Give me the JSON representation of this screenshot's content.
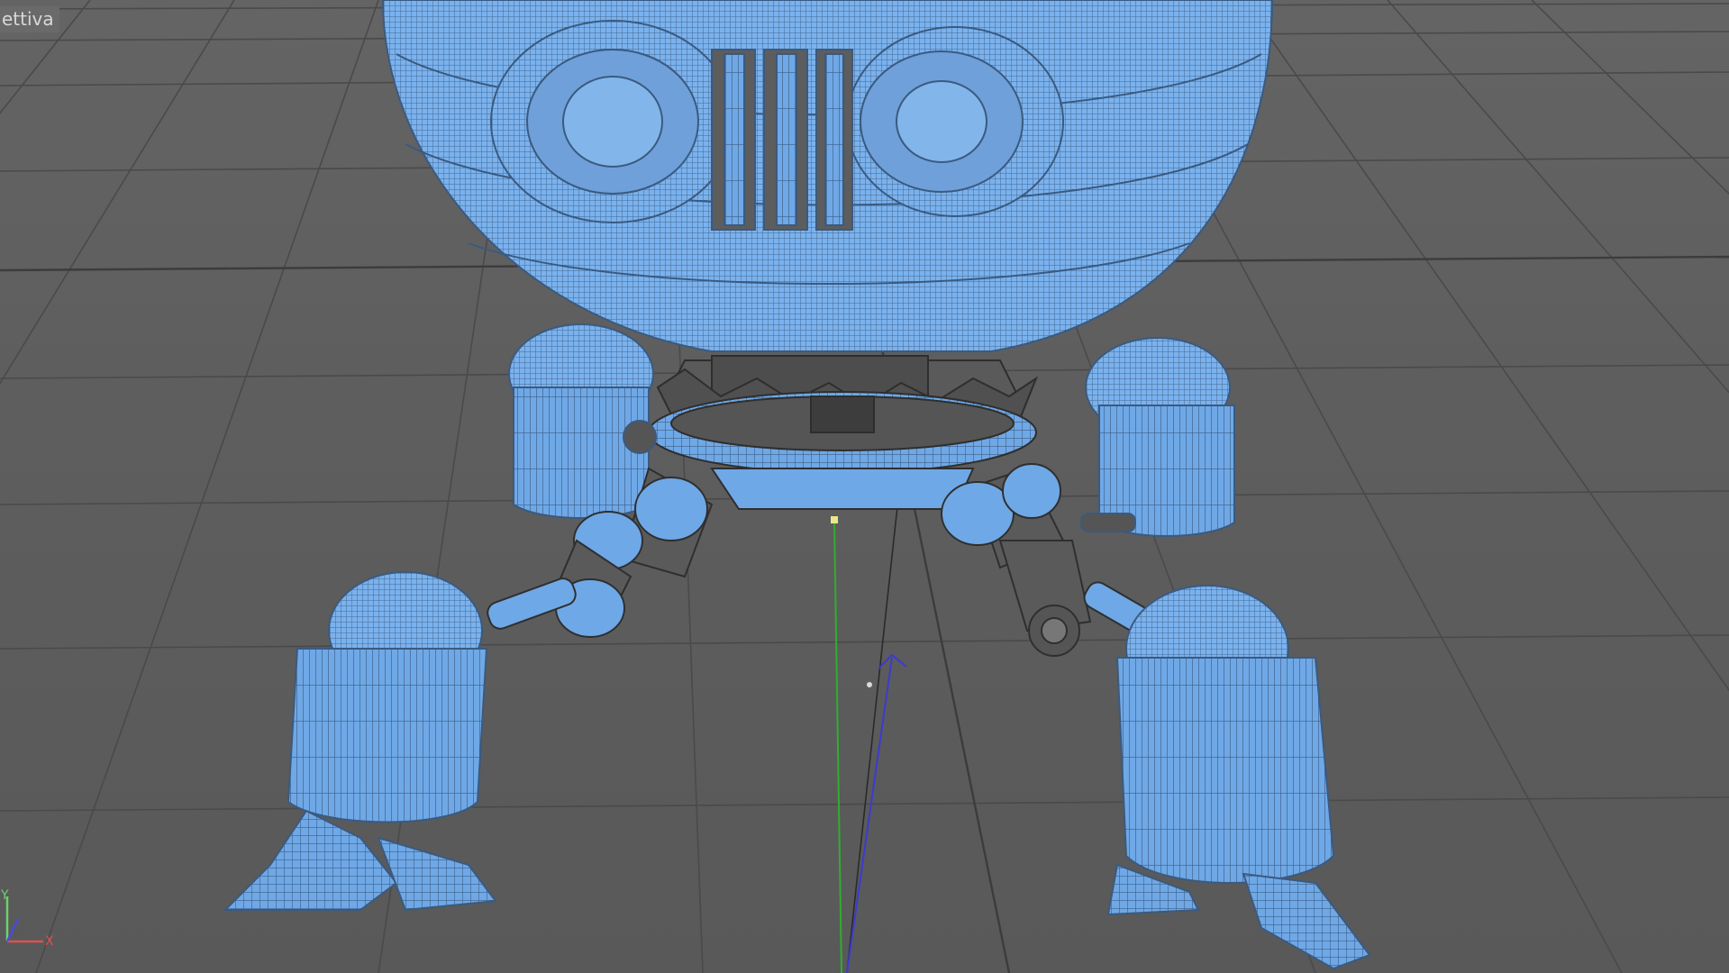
{
  "viewport": {
    "label": "ettiva",
    "background": "#5e5e5e",
    "wireframe_color": "#6fa8e6",
    "grid_color": "#4a4a4a"
  },
  "axis_gizmo": {
    "y_label": "Y",
    "x_label": "X",
    "y_color": "#6fd06f",
    "x_color": "#e05050",
    "z_color": "#4a4ae0"
  }
}
